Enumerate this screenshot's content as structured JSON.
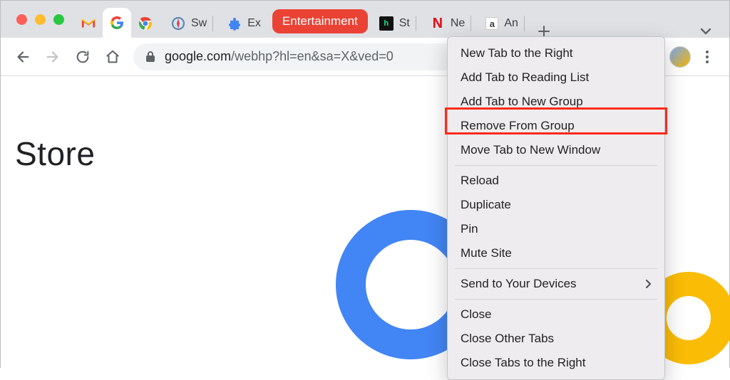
{
  "traffic_light_colors": {
    "close": "#ff5f57",
    "minimize": "#febc2e",
    "zoom": "#28c840"
  },
  "tabs": [
    {
      "icon": "gmail",
      "label": ""
    },
    {
      "icon": "google",
      "label": "",
      "active": true
    },
    {
      "icon": "chrome",
      "label": ""
    },
    {
      "icon": "globe",
      "label": "Sw"
    },
    {
      "icon": "puzzle",
      "label": "Ex"
    }
  ],
  "tab_group": {
    "label": "Entertainment",
    "color": "#ea4335"
  },
  "grouped_tabs": [
    {
      "icon": "hulu",
      "label": "St"
    },
    {
      "icon": "netflix",
      "label": "Ne"
    },
    {
      "icon": "amazon",
      "label": "An"
    }
  ],
  "address_bar": {
    "scheme_icon": "lock",
    "host": "google.com",
    "path": "/webhp?hl=en&sa=X&ved=0"
  },
  "page": {
    "heading": "Store"
  },
  "context_menu": {
    "sections": [
      [
        "New Tab to the Right",
        "Add Tab to Reading List",
        "Add Tab to New Group",
        "Remove From Group",
        "Move Tab to New Window"
      ],
      [
        "Reload",
        "Duplicate",
        "Pin",
        "Mute Site"
      ],
      [
        {
          "label": "Send to Your Devices",
          "submenu": true
        }
      ],
      [
        "Close",
        "Close Other Tabs",
        "Close Tabs to the Right"
      ]
    ],
    "highlighted": "Remove From Group"
  }
}
